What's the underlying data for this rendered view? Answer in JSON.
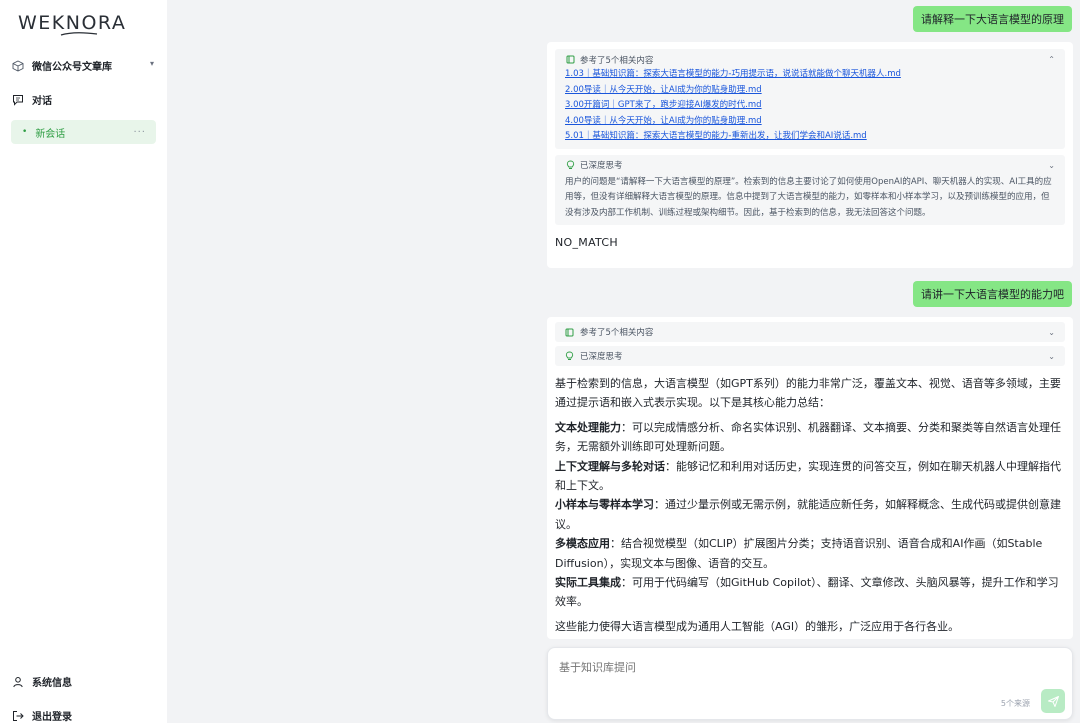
{
  "sidebar": {
    "logo": "WEKNORA",
    "knowledge_base": "微信公众号文章库",
    "chat_section": "对话",
    "session": "新会话",
    "session_more": "···",
    "system_info": "系统信息",
    "logout": "退出登录"
  },
  "conversation": [
    {
      "question": "请解释一下大语言模型的原理",
      "refs_title": "参考了5个相关内容",
      "refs": [
        "1.03｜基础知识篇：探索大语言模型的能力-巧用提示语，说说话就能做个聊天机器人.md",
        "2.00导读｜从今天开始，让AI成为你的贴身助理.md",
        "3.00开篇词｜GPT来了，跑步迎接AI爆发的时代.md",
        "4.00导读｜从今天开始，让AI成为你的贴身助理.md",
        "5.01｜基础知识篇：探索大语言模型的能力-重新出发，让我们学会和AI说话.md"
      ],
      "thinking_title": "已深度思考",
      "thinking_text": "用户的问题是“请解释一下大语言模型的原理”。检索到的信息主要讨论了如何使用OpenAI的API、聊天机器人的实现、AI工具的应用等，但没有详细解释大语言模型的原理。信息中提到了大语言模型的能力，如零样本和小样本学习，以及预训练模型的应用，但没有涉及内部工作机制、训练过程或架构细节。因此，基于检索到的信息，我无法回答这个问题。",
      "answer": "NO_MATCH"
    },
    {
      "question": "请讲一下大语言模型的能力吧",
      "refs_title": "参考了5个相关内容",
      "thinking_title": "已深度思考",
      "intro": "基于检索到的信息，大语言模型（如GPT系列）的能力非常广泛，覆盖文本、视觉、语音等多领域，主要通过提示语和嵌入式表示实现。以下是其核心能力总结：",
      "capabilities": [
        {
          "name": "文本处理能力",
          "desc": "：可以完成情感分析、命名实体识别、机器翻译、文本摘要、分类和聚类等自然语言处理任务，无需额外训练即可处理新问题。"
        },
        {
          "name": "上下文理解与多轮对话",
          "desc": "：能够记忆和利用对话历史，实现连贯的问答交互，例如在聊天机器人中理解指代和上下文。"
        },
        {
          "name": "小样本与零样本学习",
          "desc": "：通过少量示例或无需示例，就能适应新任务，如解释概念、生成代码或提供创意建议。"
        },
        {
          "name": "多模态应用",
          "desc": "：结合视觉模型（如CLIP）扩展图片分类；支持语音识别、语音合成和AI作画（如Stable Diffusion），实现文本与图像、语音的交互。"
        },
        {
          "name": "实际工具集成",
          "desc": "：可用于代码编写（如GitHub Copilot）、翻译、文章修改、头脑风暴等，提升工作和学习效率。"
        }
      ],
      "conclusion": "这些能力使得大语言模型成为通用人工智能（AGI）的雏形，广泛应用于各行各业。"
    }
  ],
  "input": {
    "placeholder": "基于知识库提问",
    "sources": "5个来源"
  },
  "colors": {
    "user_bubble": "#85e685",
    "accent": "#2f9e44",
    "link": "#1a56db"
  }
}
